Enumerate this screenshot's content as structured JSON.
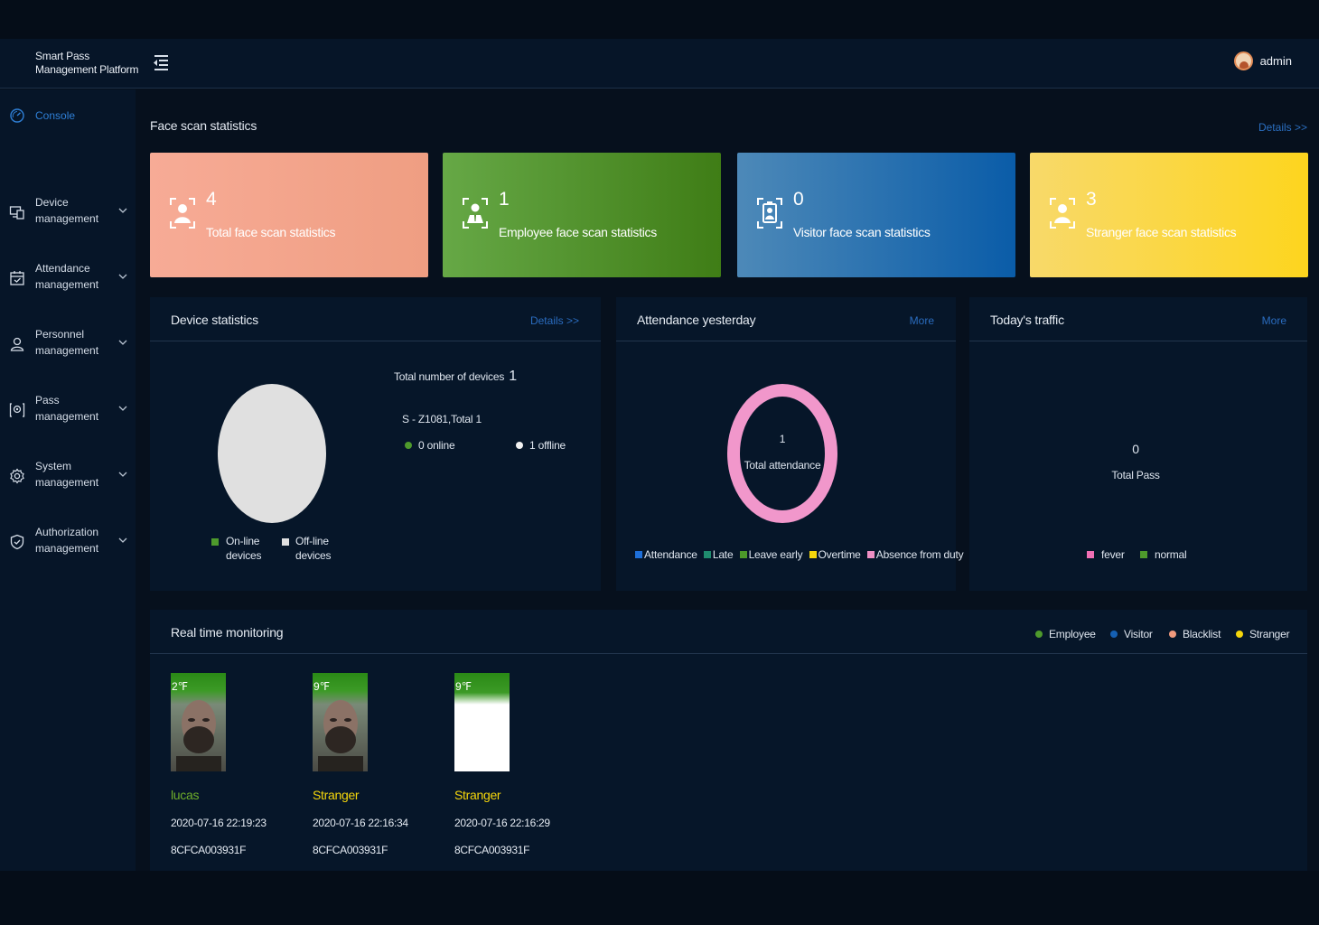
{
  "header": {
    "brand_line1": "Smart Pass",
    "brand_line2": "Management Platform",
    "user": "admin"
  },
  "sidebar": {
    "items": [
      {
        "line1": "Console",
        "line2": "",
        "icon": "gauge-icon",
        "active": true
      },
      {
        "line1": "Device",
        "line2": "management",
        "icon": "device-icon"
      },
      {
        "line1": "Attendance",
        "line2": "management",
        "icon": "calendar-check-icon"
      },
      {
        "line1": "Personnel",
        "line2": "management",
        "icon": "users-icon"
      },
      {
        "line1": "Pass",
        "line2": "management",
        "icon": "pass-icon"
      },
      {
        "line1": "System",
        "line2": "management",
        "icon": "gear-icon"
      },
      {
        "line1": "Authorization",
        "line2": "management",
        "icon": "shield-check-icon"
      }
    ]
  },
  "face_scan": {
    "title": "Face scan statistics",
    "details": "Details >>",
    "cards": [
      {
        "value": "4",
        "label": "Total face scan statistics",
        "color": "#f3a58c"
      },
      {
        "value": "1",
        "label": "Employee face scan statistics",
        "color": "#529230"
      },
      {
        "value": "0",
        "label": "Visitor face scan statistics",
        "color": "#2a72b0"
      },
      {
        "value": "3",
        "label": "Stranger face scan statistics",
        "color": "#fad641"
      }
    ]
  },
  "device_stats": {
    "title": "Device statistics",
    "details": "Details >>",
    "total_label": "Total number of devices",
    "total_value": "1",
    "model_line": "S - Z1081,Total 1",
    "online": "0 online",
    "offline": "1 offline",
    "legend_online_1": "On-line",
    "legend_online_2": "devices",
    "legend_offline_1": "Off-line",
    "legend_offline_2": "devices",
    "colors": {
      "online": "#4e9a2c",
      "offline": "#e0e0e0"
    }
  },
  "attendance": {
    "title": "Attendance yesterday",
    "more": "More",
    "center_value": "1",
    "center_label": "Total attendance",
    "legend": [
      {
        "label": "Attendance",
        "color": "#1e6fd9"
      },
      {
        "label": "Late",
        "color": "#1f8c6e"
      },
      {
        "label": "Leave early",
        "color": "#4d9a2a"
      },
      {
        "label": "Overtime",
        "color": "#f5d60b"
      },
      {
        "label": "Absence from duty",
        "color": "#ef8fc4"
      }
    ],
    "ring_color": "#f197cb"
  },
  "traffic": {
    "title": "Today's traffic",
    "more": "More",
    "value": "0",
    "label": "Total Pass",
    "legend_fever": "fever",
    "legend_normal": "normal",
    "colors": {
      "fever": "#f06fb4",
      "normal": "#4e9a2c"
    }
  },
  "realtime": {
    "title": "Real time monitoring",
    "legend": [
      {
        "label": "Employee",
        "color": "#4e9a2c"
      },
      {
        "label": "Visitor",
        "color": "#1560b3"
      },
      {
        "label": "Blacklist",
        "color": "#f19a7d"
      },
      {
        "label": "Stranger",
        "color": "#f5d60b"
      }
    ],
    "records": [
      {
        "temp": "2℉",
        "name": "lucas",
        "name_color": "#6fae2a",
        "time": "2020-07-16 22:19:23",
        "device": "8CFCA003931F",
        "photo": "face"
      },
      {
        "temp": "9℉",
        "name": "Stranger",
        "name_color": "#f5d60b",
        "time": "2020-07-16 22:16:34",
        "device": "8CFCA003931F",
        "photo": "face"
      },
      {
        "temp": "9℉",
        "name": "Stranger",
        "name_color": "#f5d60b",
        "time": "2020-07-16 22:16:29",
        "device": "8CFCA003931F",
        "photo": "blank"
      }
    ]
  }
}
